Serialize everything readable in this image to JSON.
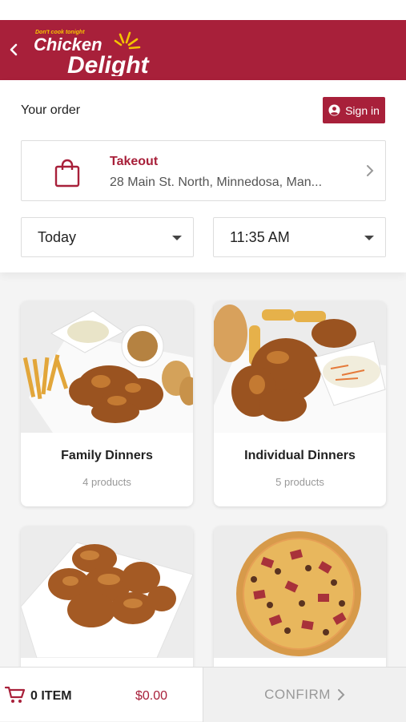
{
  "brand": {
    "tagline": "Don't cook tonight",
    "name_line1": "Chicken",
    "name_line2": "Delight",
    "accent": "#a8203a"
  },
  "header": {
    "back_icon": "chevron-left-icon"
  },
  "order": {
    "title": "Your order",
    "signin_label": "Sign in",
    "mode_title": "Takeout",
    "address": "28 Main St. North, Minnedosa, Man...",
    "date_value": "Today",
    "time_value": "11:35 AM"
  },
  "categories": [
    {
      "title": "Family Dinners",
      "count": "4 products"
    },
    {
      "title": "Individual Dinners",
      "count": "5 products"
    },
    {
      "title": "",
      "count": ""
    },
    {
      "title": "",
      "count": ""
    }
  ],
  "cart": {
    "items_label": "0 ITEM",
    "total": "$0.00",
    "confirm_label": "CONFIRM"
  }
}
